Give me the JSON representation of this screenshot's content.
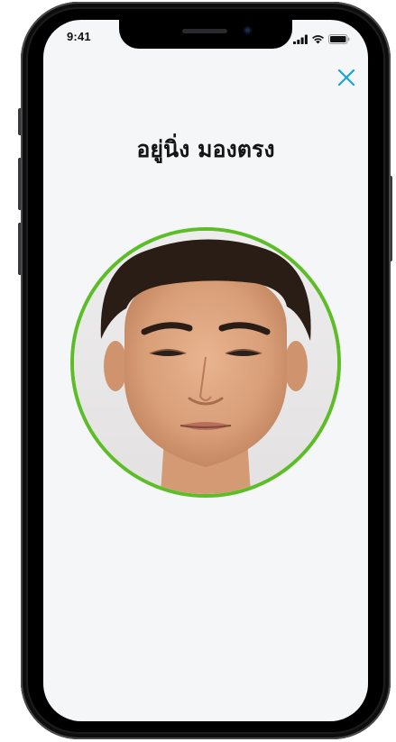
{
  "status_bar": {
    "time": "9:41",
    "icons": [
      "cellular-signal-icon",
      "wifi-icon",
      "battery-icon"
    ]
  },
  "header": {
    "close_icon": "close-icon"
  },
  "main": {
    "instruction": "อยู่นิ่ง มองตรง",
    "face_frame_color": "#5cbd26",
    "accent_color": "#1aa3d4"
  }
}
